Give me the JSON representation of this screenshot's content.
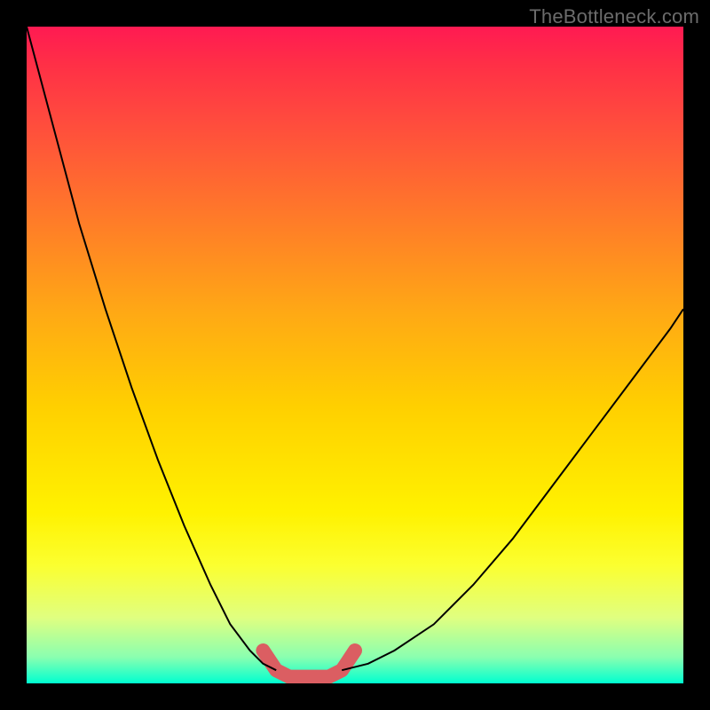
{
  "watermark": "TheBottleneck.com",
  "chart_data": {
    "type": "line",
    "title": "",
    "xlabel": "",
    "ylabel": "",
    "x_range": [
      0,
      100
    ],
    "y_range": [
      0,
      100
    ],
    "legend": false,
    "axes_visible": false,
    "grid": false,
    "background_gradient": {
      "top": "#ff1a52",
      "mid": "#fff200",
      "bottom": "#00ffd0"
    },
    "series": [
      {
        "name": "left-curve",
        "description": "descending curve from top-left to valley floor",
        "x": [
          0,
          4,
          8,
          12,
          16,
          20,
          24,
          28,
          31,
          34,
          36,
          38
        ],
        "y": [
          100,
          85,
          70,
          57,
          45,
          34,
          24,
          15,
          9,
          5,
          3,
          2
        ],
        "stroke": "#000000",
        "stroke_width": 2
      },
      {
        "name": "right-curve",
        "description": "ascending curve from valley floor toward upper-right",
        "x": [
          48,
          52,
          56,
          62,
          68,
          74,
          80,
          86,
          92,
          98,
          100
        ],
        "y": [
          2,
          3,
          5,
          9,
          15,
          22,
          30,
          38,
          46,
          54,
          57
        ],
        "stroke": "#000000",
        "stroke_width": 2
      },
      {
        "name": "valley-highlight",
        "description": "thick light-red U-shaped segment spanning the valley bottom",
        "x": [
          36,
          38,
          40,
          42,
          44,
          46,
          48,
          50
        ],
        "y": [
          5,
          2,
          1,
          1,
          1,
          1,
          2,
          5
        ],
        "stroke": "#db5e62",
        "stroke_width": 16
      }
    ]
  }
}
